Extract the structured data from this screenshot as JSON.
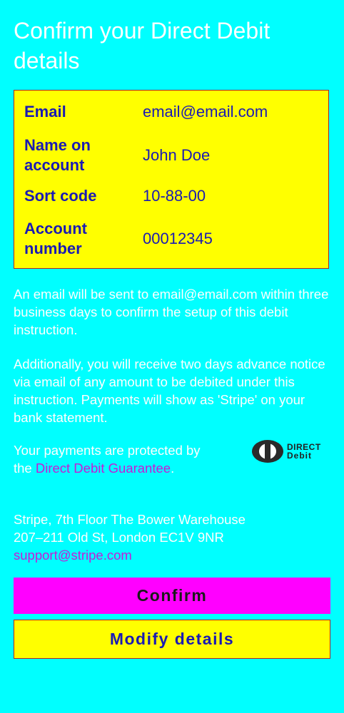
{
  "title": "Confirm your Direct Debit details",
  "details": {
    "email_label": "Email",
    "email_value": "email@email.com",
    "name_label": "Name on account",
    "name_value": "John Doe",
    "sort_label": "Sort code",
    "sort_value": "10-88-00",
    "account_label": "Account number",
    "account_value": "00012345"
  },
  "info": {
    "email_notice": "An email will be sent to email@email.com within three business days to confirm the setup of this debit instruction.",
    "advance_notice": "Additionally, you will receive two days advance notice via email of any amount to be debited under this instruction. Payments will show as 'Stripe' on your bank statement.",
    "guarantee_prefix": "Your payments are protected by the ",
    "guarantee_link": "Direct Debit Guarantee",
    "guarantee_suffix": ".",
    "address_line1": "Stripe, 7th Floor The Bower Warehouse",
    "address_line2": "207–211 Old St, London EC1V 9NR",
    "support_email": "support@stripe.com"
  },
  "logo": {
    "top": "DIRECT",
    "bottom": "Debit"
  },
  "buttons": {
    "confirm": "Confirm",
    "modify": "Modify details"
  },
  "colors": {
    "background": "#00FFFF",
    "card": "#FFFF00",
    "text_blue": "#1A1AB4",
    "link": "#C61BD6",
    "confirm_bg": "#FF00FF",
    "border": "#B22222"
  }
}
